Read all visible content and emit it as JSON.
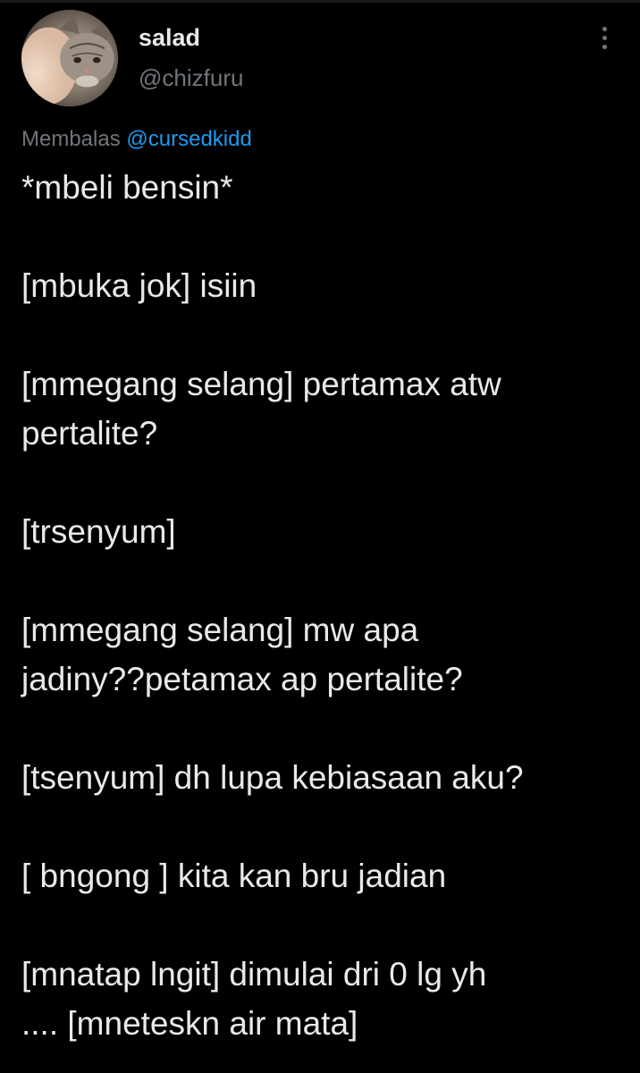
{
  "tweet": {
    "author": {
      "display_name": "salad",
      "handle": "@chizfuru"
    },
    "reply": {
      "prefix": "Membalas",
      "mention": "@cursedkidd"
    },
    "paragraphs": [
      "*mbeli bensin*",
      "[mbuka jok] isiin",
      "[mmegang selang] pertamax atw\npertalite?",
      "[trsenyum]",
      "[mmegang selang] mw apa\njadiny??petamax ap pertalite?",
      "[tsenyum] dh lupa kebiasaan aku?",
      "[ bngong ] kita kan bru jadian",
      "[mnatap lngit] dimulai dri 0 lg yh\n.... [mneteskn air mata]"
    ]
  },
  "icons": {
    "avatar": "cat-avatar-icon",
    "more": "more-vertical-icon"
  },
  "colors": {
    "background": "#000000",
    "text_primary": "#e7e9ea",
    "text_secondary": "#71767b",
    "accent": "#1d9bf0"
  }
}
